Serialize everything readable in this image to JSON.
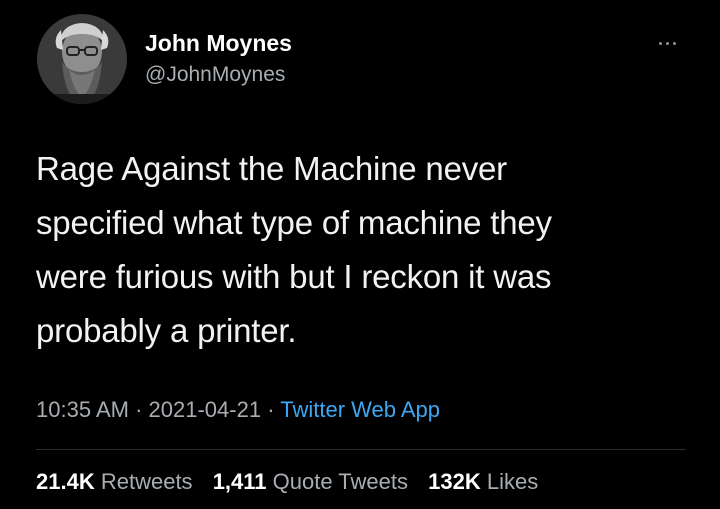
{
  "author": {
    "display_name": "John Moynes",
    "handle": "@JohnMoynes"
  },
  "tweet": {
    "text_lines": [
      "Rage Against the Machine never",
      "specified what type of machine they",
      "were furious with but I reckon it was",
      "probably a printer."
    ],
    "time": "10:35 AM",
    "date": "2021-04-21",
    "separator": "·",
    "source": "Twitter Web App"
  },
  "stats": {
    "retweets_count": "21.4K",
    "retweets_label": "Retweets",
    "quotes_count": "1,411",
    "quotes_label": "Quote Tweets",
    "likes_count": "132K",
    "likes_label": "Likes"
  },
  "icons": {
    "more": "more-options-icon"
  },
  "colors": {
    "background": "#000000",
    "primary_text": "#ffffff",
    "secondary_text": "#a8adb2",
    "link": "#3ea6f2"
  }
}
